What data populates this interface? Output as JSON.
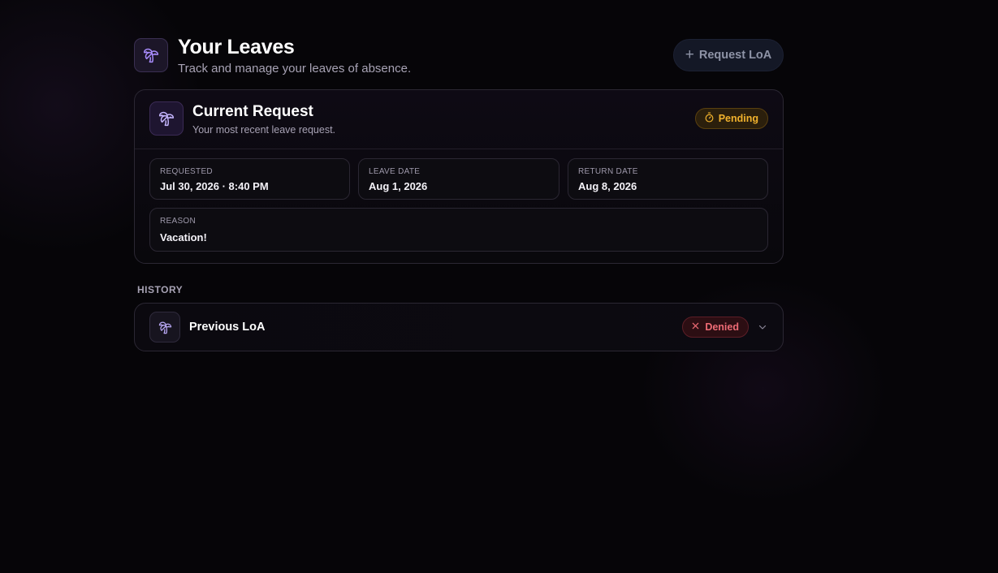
{
  "header": {
    "title": "Your Leaves",
    "subtitle": "Track and manage your leaves of absence.",
    "icon": "palm-tree-icon",
    "request_button": {
      "icon": "plus-icon",
      "label": "Request LoA"
    }
  },
  "current_request": {
    "title": "Current Request",
    "subtitle": "Your most recent leave request.",
    "icon": "palm-tree-icon",
    "status": {
      "label": "Pending",
      "icon": "timer-icon",
      "color": "#f1b22d"
    },
    "fields": {
      "requested": {
        "label": "REQUESTED",
        "value": "Jul 30, 2026 · 8:40 PM"
      },
      "leave_date": {
        "label": "LEAVE DATE",
        "value": "Aug 1, 2026"
      },
      "return_date": {
        "label": "RETURN DATE",
        "value": "Aug 8, 2026"
      },
      "reason": {
        "label": "REASON",
        "value": "Vacation!"
      }
    }
  },
  "history": {
    "label": "HISTORY",
    "items": [
      {
        "title": "Previous LoA",
        "icon": "palm-tree-icon",
        "status": {
          "label": "Denied",
          "icon": "x-icon",
          "color": "#ee6b75"
        },
        "expand_icon": "chevron-down-icon"
      }
    ]
  },
  "colors": {
    "accent": "#a78bfa",
    "background": "#060508",
    "pending": "#f1b22d",
    "denied": "#ee6b75"
  }
}
